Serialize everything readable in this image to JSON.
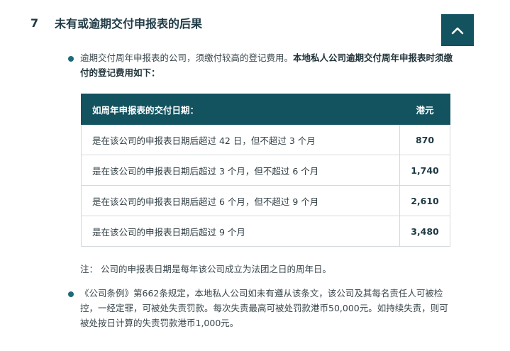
{
  "section": {
    "number": "7",
    "title": "未有或逾期交付申报表的后果"
  },
  "back_to_top": {
    "icon": "chevron-up-icon",
    "color": "#13525f"
  },
  "bullet1": {
    "text_plain": "逾期交付周年申报表的公司，须缴付较高的登记费用。",
    "text_bold": "本地私人公司逾期交付周年申报表时须缴付的登记费用如下："
  },
  "fee_table": {
    "headers": [
      "如周年申报表的交付日期：",
      "港元"
    ],
    "rows": [
      {
        "condition": "是在该公司的申报表日期后超过 42 日，但不超过 3 个月",
        "fee": "870"
      },
      {
        "condition": "是在该公司的申报表日期后超过 3 个月，但不超过 6 个月",
        "fee": "1,740"
      },
      {
        "condition": "是在该公司的申报表日期后超过 6 个月，但不超过 9 个月",
        "fee": "2,610"
      },
      {
        "condition": "是在该公司的申报表日期后超过 9 个月",
        "fee": "3,480"
      }
    ]
  },
  "note": "注： 公司的申报表日期是每年该公司成立为法团之日的周年日。",
  "bullet2": {
    "text": "《公司条例》第662条规定，本地私人公司如未有遵从该条文，该公司及其每名责任人可被检控，一经定罪，可被处失责罚款。每次失责最高可被处罚款港币50,000元。如持续失责，则可被处按日计算的失责罚款港币1,000元。"
  },
  "colors": {
    "header_bg": "#13525f",
    "bullet": "#1e6b78"
  }
}
